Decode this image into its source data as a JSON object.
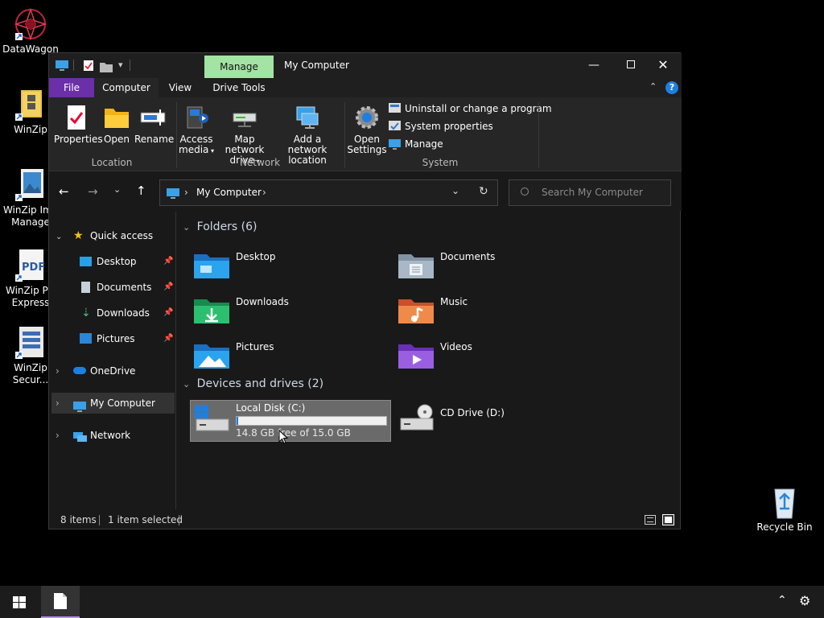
{
  "desktop": {
    "icons": [
      {
        "label": "DataWagon",
        "icon": "datawagon-icon"
      },
      {
        "label": "WinZip",
        "icon": "winzip-icon"
      },
      {
        "label": "WinZip Ima Manage",
        "icon": "winzip-image-manager-icon"
      },
      {
        "label": "WinZip PD Express",
        "icon": "winzip-pdf-express-icon"
      },
      {
        "label": "WinZip Secur...",
        "icon": "winzip-secure-icon"
      }
    ],
    "recycle_bin": "Recycle Bin"
  },
  "window": {
    "title": "My Computer",
    "contextual_tab": "Manage",
    "tabs": {
      "file": "File",
      "computer": "Computer",
      "view": "View",
      "drive_tools": "Drive Tools"
    },
    "ribbon": {
      "properties": "Properties",
      "open": "Open",
      "rename": "Rename",
      "access_media_1": "Access",
      "access_media_2": "media",
      "map_drive_1": "Map network",
      "map_drive_2": "drive",
      "add_location_1": "Add a network",
      "add_location_2": "location",
      "open_settings_1": "Open",
      "open_settings_2": "Settings",
      "uninstall": "Uninstall or change a program",
      "system_properties": "System properties",
      "manage": "Manage",
      "group_location": "Location",
      "group_network": "Network",
      "group_system": "System"
    },
    "address": {
      "path": "My Computer"
    },
    "search": {
      "placeholder": "Search My Computer"
    },
    "sidebar": {
      "quick_access": "Quick access",
      "items": [
        "Desktop",
        "Documents",
        "Downloads",
        "Pictures"
      ],
      "onedrive": "OneDrive",
      "my_computer": "My Computer",
      "network": "Network"
    },
    "content": {
      "folders_header": "Folders (6)",
      "folders": [
        "Desktop",
        "Documents",
        "Downloads",
        "Music",
        "Pictures",
        "Videos"
      ],
      "drives_header": "Devices and drives (2)",
      "drive_c": {
        "name": "Local Disk (C:)",
        "free": "14.8 GB free of 15.0 GB",
        "used_fraction": 0.013
      },
      "drive_d": {
        "name": "CD Drive (D:)"
      }
    },
    "status": {
      "items": "8 items",
      "selected": "1 item selected"
    }
  },
  "colors": {
    "accent": "#1e90ff",
    "manage_tab": "#a3e3a3",
    "file_tab": "#6b2fa8",
    "selected": "#3a3a3a"
  }
}
